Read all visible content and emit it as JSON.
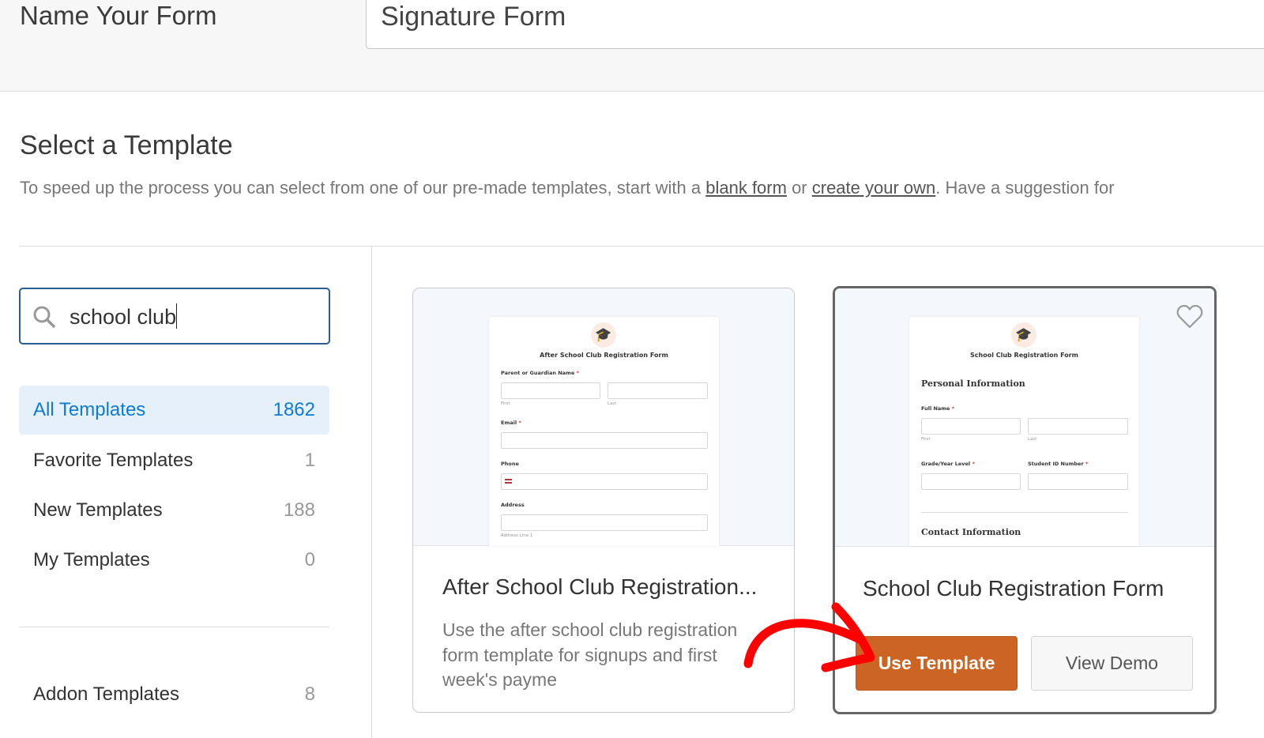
{
  "header": {
    "name_label": "Name Your Form",
    "form_name": "Signature Form"
  },
  "select": {
    "title": "Select a Template",
    "desc_prefix": "To speed up the process you can select from one of our pre-made templates, start with a ",
    "blank_link": "blank form",
    "desc_or": " or ",
    "create_link": "create your own",
    "desc_suffix": ". Have a suggestion for"
  },
  "search": {
    "value": "school club"
  },
  "sidebar": {
    "items": [
      {
        "label": "All Templates",
        "count": "1862",
        "active": true
      },
      {
        "label": "Favorite Templates",
        "count": "1"
      },
      {
        "label": "New Templates",
        "count": "188"
      },
      {
        "label": "My Templates",
        "count": "0"
      }
    ],
    "addon": {
      "label": "Addon Templates",
      "count": "8"
    }
  },
  "cards": [
    {
      "title": "After School Club Registration...",
      "desc": "Use the after school club registration form template for signups and first week's payme",
      "preview": {
        "title": "After School Club Registration Form",
        "parent_label": "Parent or Guardian Name",
        "first": "First",
        "last": "Last",
        "email_label": "Email",
        "phone_label": "Phone",
        "address_label": "Address",
        "address_line": "Address Line 1"
      }
    },
    {
      "title": "School Club Registration Form",
      "use_label": "Use Template",
      "demo_label": "View Demo",
      "preview": {
        "title": "School Club Registration Form",
        "section1": "Personal Information",
        "fullname_label": "Full Name",
        "first": "First",
        "last": "Last",
        "grade_label": "Grade/Year Level",
        "student_id_label": "Student ID Number",
        "section2": "Contact Information"
      }
    }
  ],
  "colors": {
    "accent": "#cc6523",
    "active_blue": "#0e7bd0",
    "annotation_arrow": "#ff0000"
  }
}
